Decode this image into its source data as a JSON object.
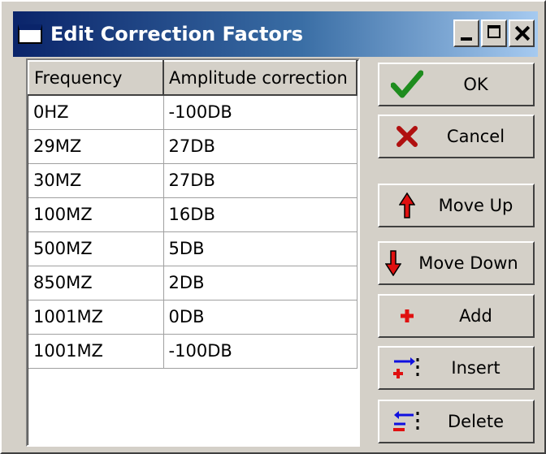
{
  "window": {
    "title": "Edit Correction Factors"
  },
  "title_buttons": {
    "minimize": "minimize-icon",
    "maximize": "maximize-icon",
    "close": "close-icon"
  },
  "table": {
    "columns": [
      "Frequency",
      "Amplitude correction"
    ],
    "rows": [
      [
        "0HZ",
        "-100DB"
      ],
      [
        "29MZ",
        "27DB"
      ],
      [
        "30MZ",
        "27DB"
      ],
      [
        "100MZ",
        "16DB"
      ],
      [
        "500MZ",
        "5DB"
      ],
      [
        "850MZ",
        "2DB"
      ],
      [
        "1001MZ",
        "0DB"
      ],
      [
        "1001MZ",
        "-100DB"
      ]
    ]
  },
  "buttons": {
    "ok": {
      "label": "OK",
      "icon": "checkmark-icon",
      "color": "#1e8c1e"
    },
    "cancel": {
      "label": "Cancel",
      "icon": "x-mark-icon",
      "color": "#b01010"
    },
    "move_up": {
      "label": "Move Up",
      "icon": "arrow-up-icon",
      "color": "#e01010"
    },
    "move_down": {
      "label": "Move Down",
      "icon": "arrow-down-icon",
      "color": "#e01010"
    },
    "add": {
      "label": "Add",
      "icon": "plus-icon",
      "color": "#e01010"
    },
    "insert": {
      "label": "Insert",
      "icon": "insert-row-icon",
      "color": "#1010e0"
    },
    "delete": {
      "label": "Delete",
      "icon": "delete-row-icon",
      "color": "#1010e0"
    }
  }
}
